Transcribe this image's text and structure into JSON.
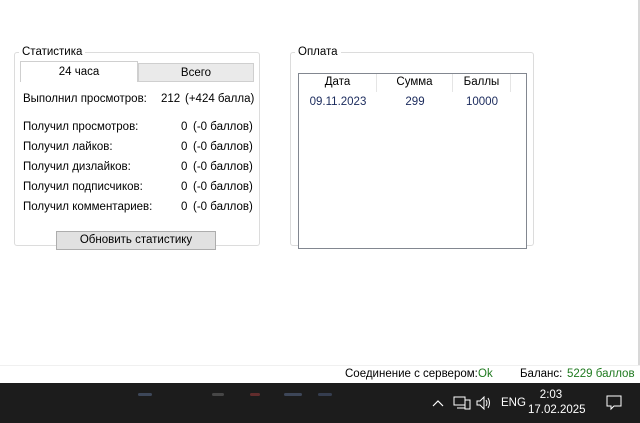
{
  "stats": {
    "legend": "Статистика",
    "tabs": [
      {
        "label": "24 часа"
      },
      {
        "label": "Всего"
      }
    ],
    "rows": [
      {
        "label": "Выполнил просмотров:",
        "value": "212",
        "bonus": "(+424 балла)"
      },
      {
        "label": "Получил просмотров:",
        "value": "0",
        "bonus": "(-0 баллов)"
      },
      {
        "label": "Получил лайков:",
        "value": "0",
        "bonus": "(-0 баллов)"
      },
      {
        "label": "Получил дизлайков:",
        "value": "0",
        "bonus": "(-0 баллов)"
      },
      {
        "label": "Получил подписчиков:",
        "value": "0",
        "bonus": "(-0 баллов)"
      },
      {
        "label": "Получил комментариев:",
        "value": "0",
        "bonus": "(-0 баллов)"
      }
    ],
    "refresh_label": "Обновить статистику"
  },
  "payment": {
    "legend": "Оплата",
    "columns": [
      "Дата",
      "Сумма",
      "Баллы"
    ],
    "rows": [
      [
        "09.11.2023",
        "299",
        "10000"
      ]
    ]
  },
  "status": {
    "connection_label": "Соединение с сервером:",
    "connection_value": "Ok",
    "balance_label": "Баланс:",
    "balance_value": "5229 баллов"
  },
  "taskbar": {
    "language": "ENG",
    "time": "2:03",
    "date": "17.02.2025",
    "icons": [
      "chevron-up-icon",
      "network-icon",
      "volume-icon",
      "notification-icon"
    ]
  },
  "colors": {
    "ok_green": "#1f7a1f",
    "list_text": "#1a2a5c",
    "taskbar_bg": "#1c1c1c"
  }
}
